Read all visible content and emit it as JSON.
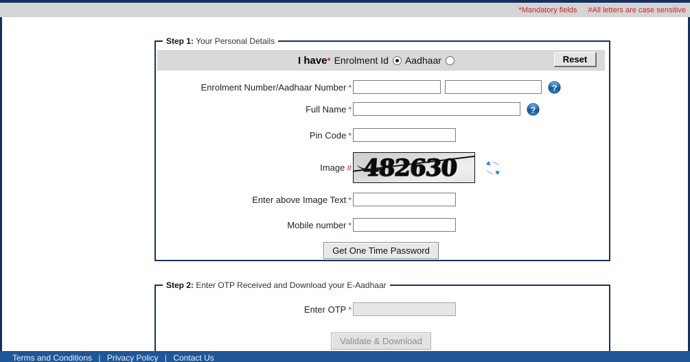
{
  "header": {
    "mandatory_note": "*Mandatory fields",
    "case_sensitive_note": "#All letters are case sensitive"
  },
  "step1": {
    "legend_label": "Step 1:",
    "legend_text": " Your Personal Details",
    "i_have_label": "I have",
    "i_have_star": "*",
    "option_enrolment_label": "Enrolment Id",
    "option_aadhaar_label": "Aadhaar",
    "selected_option": "Enrolment Id",
    "reset_label": "Reset",
    "fields": {
      "enrolment_number_label": "Enrolment Number/Aadhaar Number",
      "enrolment_number_part1_value": "",
      "enrolment_number_part2_value": "",
      "full_name_label": "Full Name",
      "full_name_value": "",
      "pin_code_label": "Pin Code",
      "pin_code_value": "",
      "image_label": "Image",
      "captcha_text": "482630",
      "image_text_label": "Enter above Image Text",
      "image_text_value": "",
      "mobile_number_label": "Mobile number",
      "mobile_number_value": ""
    },
    "get_otp_label": "Get One Time Password"
  },
  "step2": {
    "legend_label": "Step 2:",
    "legend_text": " Enter OTP Received and Download your E-Aadhaar",
    "otp_label": "Enter OTP",
    "otp_value": "",
    "validate_label": "Validate & Download"
  },
  "footer": {
    "terms_label": "Terms and Conditions",
    "privacy_label": "Privacy Policy",
    "contact_label": "Contact Us",
    "separator": "|"
  },
  "icons": {
    "help": "help-icon",
    "refresh": "refresh-icon"
  },
  "colors": {
    "navy": "#16305c",
    "footer_blue": "#1f5697",
    "required_red": "#c62828",
    "header_gray": "#d4d4d4"
  }
}
